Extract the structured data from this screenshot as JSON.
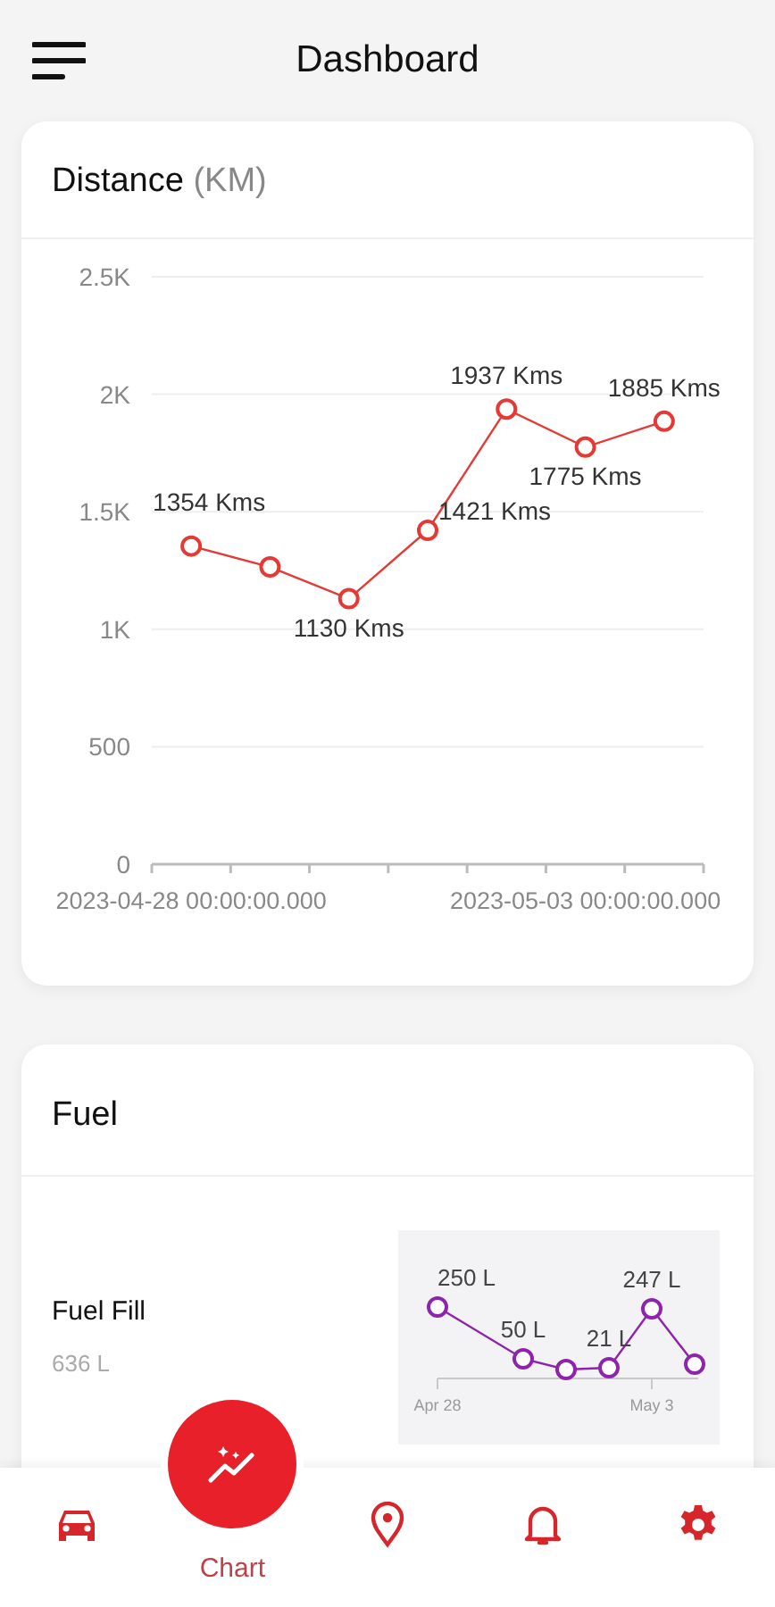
{
  "header": {
    "title": "Dashboard"
  },
  "distance": {
    "title": "Distance",
    "unit": "(KM)",
    "chart_data": {
      "type": "line",
      "categories": [
        "2023-04-28 00:00:00.000",
        null,
        null,
        null,
        null,
        "2023-05-03 00:00:00.000",
        null
      ],
      "ylim": [
        0,
        2500
      ],
      "yticks": [
        0,
        500,
        {
          "value": 1000,
          "label": "1K"
        },
        {
          "value": 1500,
          "label": "1.5K"
        },
        {
          "value": 2000,
          "label": "2K"
        },
        {
          "value": 2500,
          "label": "2.5K"
        }
      ],
      "grid": true,
      "series": [
        {
          "color": "#e53935",
          "marker": "circle",
          "values": [
            1354,
            1265,
            1130,
            1421,
            1937,
            1775,
            1885
          ]
        }
      ],
      "value_labels": [
        "1354 Kms",
        null,
        "1130 Kms",
        "1421 Kms",
        "1937 Kms",
        "1775 Kms",
        "1885 Kms"
      ]
    }
  },
  "fuel": {
    "title": "Fuel",
    "metric": {
      "label": "Fuel Fill",
      "value": "636 L"
    },
    "sparkline": {
      "point_labels": [
        "250 L",
        "50 L",
        "21 L",
        "247 L"
      ],
      "axis_labels": [
        "Apr 28",
        "May 3"
      ]
    }
  },
  "nav": [
    {
      "kind": "car",
      "selected": false
    },
    {
      "kind": "chart",
      "label": "Chart",
      "selected": true
    },
    {
      "kind": "pin",
      "selected": false
    },
    {
      "kind": "bell",
      "selected": false
    },
    {
      "kind": "gear",
      "selected": false
    }
  ]
}
